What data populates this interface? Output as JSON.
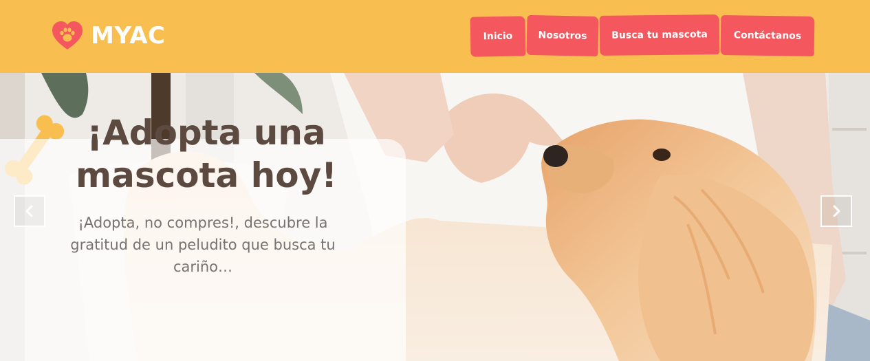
{
  "header": {
    "logo_text": "MYAC",
    "logo_icon": "heart-paw-icon",
    "nav": [
      {
        "label": "Inicio"
      },
      {
        "label": "Nosotros"
      },
      {
        "label": "Busca tu mascota"
      },
      {
        "label": "Contáctanos"
      }
    ]
  },
  "hero": {
    "title": "¡Adopta una mascota hoy!",
    "text": "¡Adopta, no compres!, descubre la gratitud de un peludito que busca tu cariño…",
    "prev_icon": "chevron-left-icon",
    "next_icon": "chevron-right-icon",
    "decoration_icon": "bone-icon"
  },
  "colors": {
    "header_bg": "#f9be50",
    "nav_bg": "#f4575d",
    "logo_heart": "#f4575d",
    "title": "#5c4a40",
    "text": "#777170"
  }
}
